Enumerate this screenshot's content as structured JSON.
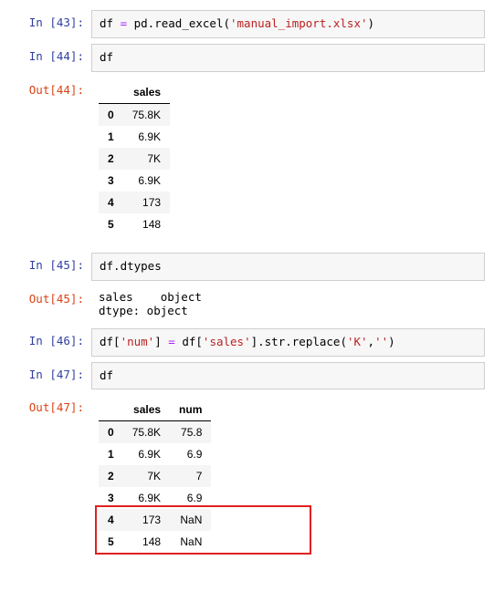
{
  "cells": {
    "c43": {
      "prompt": "In [43]:",
      "code_parts": [
        "df ",
        "=",
        " pd.read_excel(",
        "'manual_import.xlsx'",
        ")"
      ]
    },
    "c44_in": {
      "prompt": "In [44]:",
      "code": "df"
    },
    "c44_out": {
      "prompt": "Out[44]:"
    },
    "c45_in": {
      "prompt": "In [45]:",
      "code": "df.dtypes"
    },
    "c45_out": {
      "prompt": "Out[45]:",
      "text": "sales    object\ndtype: object"
    },
    "c46": {
      "prompt": "In [46]:",
      "code_parts": [
        "df[",
        "'num'",
        "] ",
        "=",
        " df[",
        "'sales'",
        "].str.replace(",
        "'K'",
        ",",
        "''",
        ")"
      ]
    },
    "c47_in": {
      "prompt": "In [47]:",
      "code": "df"
    },
    "c47_out": {
      "prompt": "Out[47]:"
    }
  },
  "table1": {
    "col0": "sales",
    "rows": [
      {
        "idx": "0",
        "sales": "75.8K"
      },
      {
        "idx": "1",
        "sales": "6.9K"
      },
      {
        "idx": "2",
        "sales": "7K"
      },
      {
        "idx": "3",
        "sales": "6.9K"
      },
      {
        "idx": "4",
        "sales": "173"
      },
      {
        "idx": "5",
        "sales": "148"
      }
    ]
  },
  "table2": {
    "col0": "sales",
    "col1": "num",
    "rows": [
      {
        "idx": "0",
        "sales": "75.8K",
        "num": "75.8"
      },
      {
        "idx": "1",
        "sales": "6.9K",
        "num": "6.9"
      },
      {
        "idx": "2",
        "sales": "7K",
        "num": "7"
      },
      {
        "idx": "3",
        "sales": "6.9K",
        "num": "6.9"
      },
      {
        "idx": "4",
        "sales": "173",
        "num": "NaN"
      },
      {
        "idx": "5",
        "sales": "148",
        "num": "NaN"
      }
    ]
  }
}
